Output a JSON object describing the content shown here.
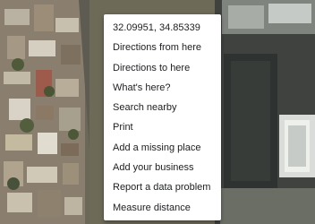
{
  "map": {
    "view": "satellite"
  },
  "context_menu": {
    "items": [
      {
        "label": "32.09951, 34.85339"
      },
      {
        "label": "Directions from here"
      },
      {
        "label": "Directions to here"
      },
      {
        "label": "What's here?"
      },
      {
        "label": "Search nearby"
      },
      {
        "label": "Print"
      },
      {
        "label": "Add a missing place"
      },
      {
        "label": "Add your business"
      },
      {
        "label": "Report a data problem"
      },
      {
        "label": "Measure distance"
      }
    ]
  }
}
